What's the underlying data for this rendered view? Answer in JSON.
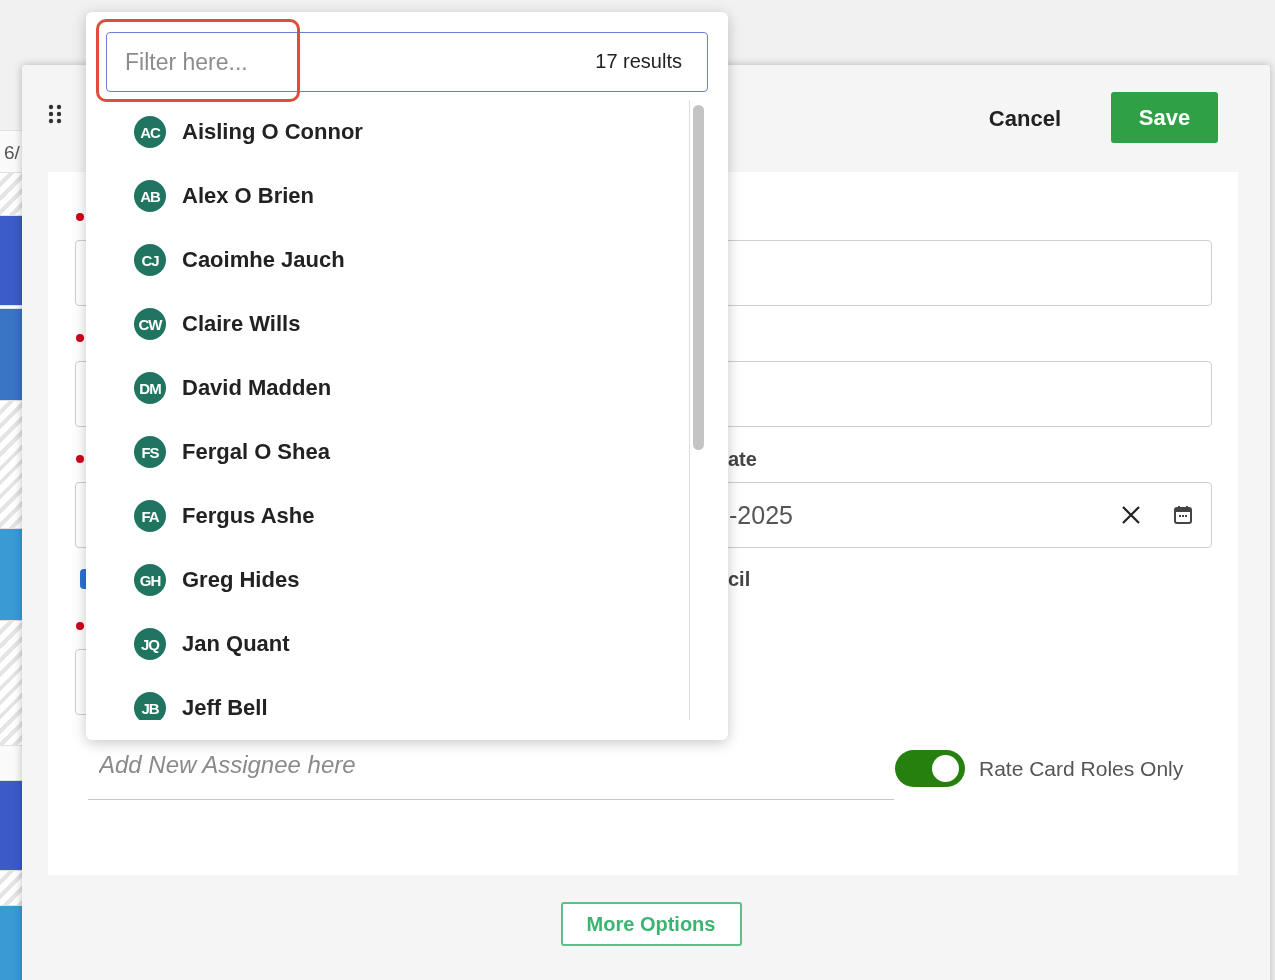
{
  "calendar": {
    "date_fragment": "6/",
    "cells": [
      {
        "kind": "blank"
      },
      {
        "kind": "striped"
      },
      {
        "kind": "event",
        "color": "#3b5cc9"
      },
      {
        "kind": "blank"
      },
      {
        "kind": "event",
        "color": "#3a74c4"
      },
      {
        "kind": "striped"
      },
      {
        "kind": "event",
        "color": "#3a9ad4"
      },
      {
        "kind": "striped"
      },
      {
        "kind": "blank"
      },
      {
        "kind": "event",
        "color": "#3c5bc8"
      },
      {
        "kind": "striped"
      },
      {
        "kind": "event",
        "color": "#3a9ad4"
      }
    ]
  },
  "dialog": {
    "cancel": "Cancel",
    "save": "Save",
    "fields": [
      {
        "kind": "text",
        "required": true
      },
      {
        "kind": "text",
        "required": true
      },
      {
        "kind": "date",
        "required": true,
        "label": "ate",
        "value": "-2025"
      },
      {
        "kind": "checkbox",
        "checked": true,
        "label": "cil"
      },
      {
        "kind": "text",
        "required": true
      }
    ],
    "assignee": {
      "placeholder": "Add New Assignee here"
    },
    "rate_card_toggle": {
      "label": "Rate Card Roles Only",
      "on": true
    },
    "more_options": "More Options"
  },
  "dropdown": {
    "filter": {
      "placeholder": "Filter here...",
      "count": "17 results",
      "highlighted": true
    },
    "options": [
      {
        "initials": "AC",
        "name": "Aisling O Connor"
      },
      {
        "initials": "AB",
        "name": "Alex O Brien"
      },
      {
        "initials": "CJ",
        "name": "Caoimhe Jauch"
      },
      {
        "initials": "CW",
        "name": "Claire Wills"
      },
      {
        "initials": "DM",
        "name": "David Madden"
      },
      {
        "initials": "FS",
        "name": "Fergal O Shea"
      },
      {
        "initials": "FA",
        "name": "Fergus Ashe"
      },
      {
        "initials": "GH",
        "name": "Greg Hides"
      },
      {
        "initials": "JQ",
        "name": "Jan Quant"
      },
      {
        "initials": "JB",
        "name": "Jeff Bell"
      }
    ]
  }
}
